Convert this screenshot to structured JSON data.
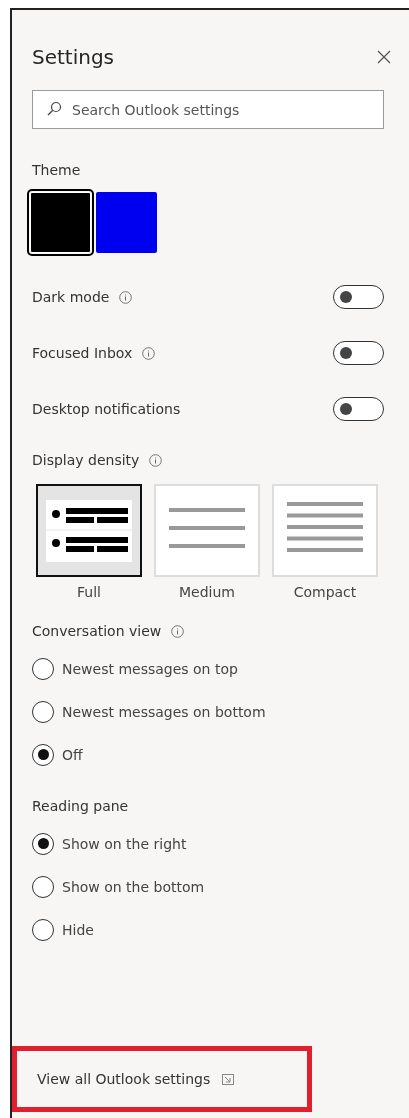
{
  "panel": {
    "title": "Settings"
  },
  "search": {
    "placeholder": "Search Outlook settings"
  },
  "theme": {
    "label": "Theme",
    "swatches": [
      {
        "color": "#000000",
        "selected": true
      },
      {
        "color": "#0000f0",
        "selected": false
      }
    ]
  },
  "toggles": [
    {
      "label": "Dark mode",
      "info": true,
      "on": false
    },
    {
      "label": "Focused Inbox",
      "info": true,
      "on": false
    },
    {
      "label": "Desktop notifications",
      "info": false,
      "on": false
    }
  ],
  "density": {
    "label": "Display density",
    "info": true,
    "options": [
      {
        "label": "Full",
        "kind": "full",
        "selected": true
      },
      {
        "label": "Medium",
        "kind": "medium",
        "selected": false
      },
      {
        "label": "Compact",
        "kind": "compact",
        "selected": false
      }
    ]
  },
  "radio_groups": [
    {
      "label": "Conversation view",
      "info": true,
      "options": [
        {
          "label": "Newest messages on top",
          "selected": false
        },
        {
          "label": "Newest messages on bottom",
          "selected": false
        },
        {
          "label": "Off",
          "selected": true
        }
      ]
    },
    {
      "label": "Reading pane",
      "info": false,
      "options": [
        {
          "label": "Show on the right",
          "selected": true
        },
        {
          "label": "Show on the bottom",
          "selected": false
        },
        {
          "label": "Hide",
          "selected": false
        }
      ]
    }
  ],
  "footer_link": {
    "text": "View all Outlook settings",
    "highlighted": true
  }
}
